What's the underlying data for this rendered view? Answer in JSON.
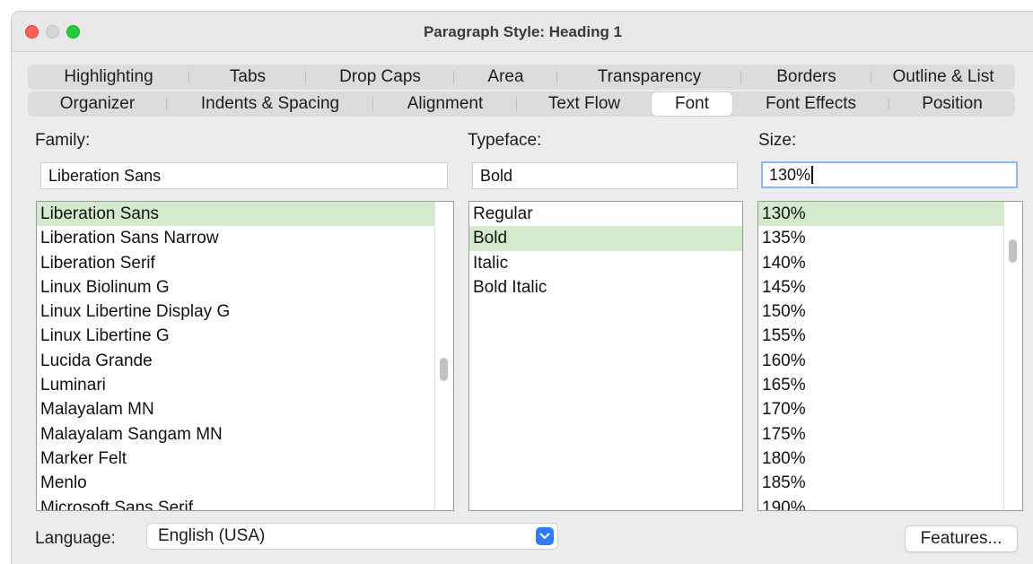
{
  "window": {
    "title": "Paragraph Style: Heading 1"
  },
  "tabs": {
    "row1": [
      "Highlighting",
      "Tabs",
      "Drop Caps",
      "Area",
      "Transparency",
      "Borders",
      "Outline & List"
    ],
    "row2": [
      "Organizer",
      "Indents & Spacing",
      "Alignment",
      "Text Flow",
      "Font",
      "Font Effects",
      "Position"
    ],
    "active": "Font"
  },
  "family": {
    "label": "Family:",
    "value": "Liberation Sans",
    "selected": "Liberation Sans",
    "options": [
      "Liberation Sans",
      "Liberation Sans Narrow",
      "Liberation Serif",
      "Linux Biolinum G",
      "Linux Libertine Display G",
      "Linux Libertine G",
      "Lucida Grande",
      "Luminari",
      "Malayalam MN",
      "Malayalam Sangam MN",
      "Marker Felt",
      "Menlo",
      "Microsoft Sans Serif"
    ]
  },
  "typeface": {
    "label": "Typeface:",
    "value": "Bold",
    "selected": "Bold",
    "options": [
      "Regular",
      "Bold",
      "Italic",
      "Bold Italic"
    ]
  },
  "size": {
    "label": "Size:",
    "value": "130%",
    "selected": "130%",
    "options": [
      "130%",
      "135%",
      "140%",
      "145%",
      "150%",
      "155%",
      "160%",
      "165%",
      "170%",
      "175%",
      "180%",
      "185%",
      "190%"
    ]
  },
  "language": {
    "label": "Language:",
    "value": "English (USA)"
  },
  "buttons": {
    "features": "Features..."
  },
  "colors": {
    "selection": "#d3ebcc",
    "focus_ring": "#8fb6ea",
    "select_arrow": "#2f7cf6"
  }
}
